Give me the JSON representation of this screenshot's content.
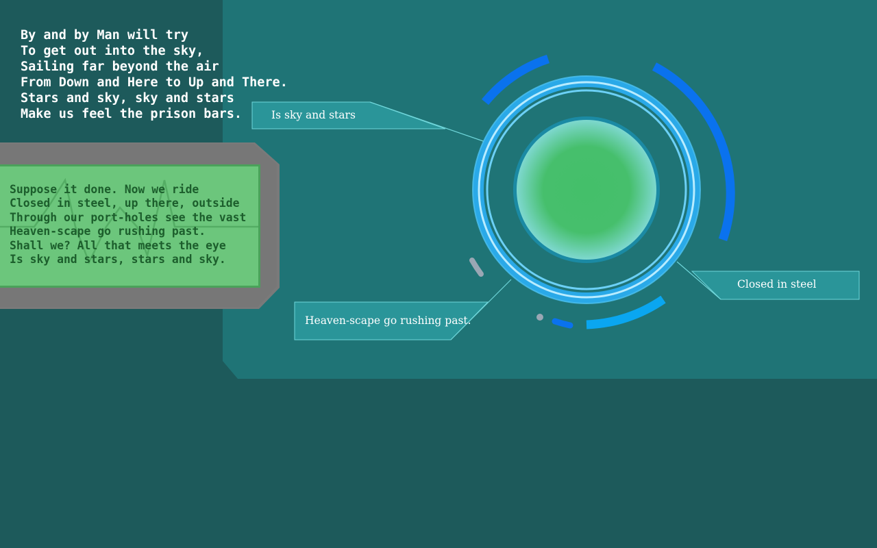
{
  "poem_top": {
    "lines": [
      "By and by Man will try",
      "To get out into the sky,",
      "Sailing far beyond the air",
      "From Down and Here to Up and There.",
      "Stars and sky, sky and stars",
      "Make us feel the prison bars."
    ]
  },
  "poem_screen": {
    "lines": [
      "Suppose it done. Now we ride",
      "Closed in steel, up there, outside",
      "Through our port-holes see the vast",
      "Heaven-scape go rushing past.",
      "Shall we? All that meets the eye",
      "Is sky and stars, stars and sky."
    ]
  },
  "callouts": {
    "upper_left": "Is sky and stars",
    "right": "Closed in steel",
    "lower_left": "Heaven-scape go rushing past."
  },
  "colors": {
    "background": "#1d5a5b",
    "panel": "#1f7476",
    "screen": "#6cc67c",
    "ring": "#2aa9e8",
    "orb": "#44bf6a",
    "arc_blue": "#0a72ee",
    "callout_box": "#2a9599"
  }
}
